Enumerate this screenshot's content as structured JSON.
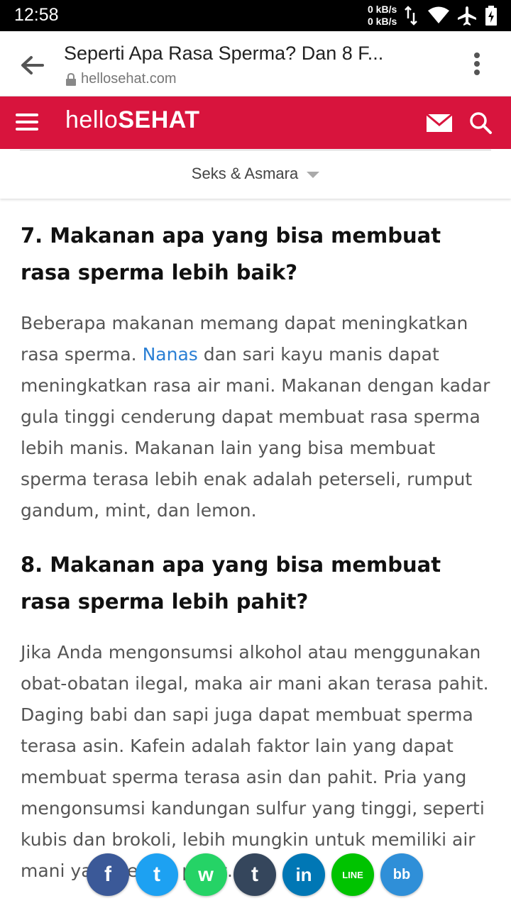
{
  "status": {
    "time": "12:58",
    "net_up": "0 kB/s",
    "net_down": "0 kB/s"
  },
  "browser": {
    "title": "Seperti Apa Rasa Sperma? Dan 8 F...",
    "domain": "hellosehat.com"
  },
  "header": {
    "logo_left": "hello",
    "logo_right": "SEHAT",
    "brand_color": "#d8143d"
  },
  "subnav": {
    "category": "Seks & Asmara"
  },
  "article": {
    "h7": "7. Makanan apa yang bisa membuat rasa sperma lebih baik?",
    "p7_before": "Beberapa makanan memang dapat meningkatkan rasa sperma. ",
    "p7_link": "Nanas",
    "p7_after": " dan sari kayu manis dapat meningkatkan rasa air mani. Makanan dengan kadar gula tinggi cenderung dapat membuat rasa sperma lebih manis. Makanan lain yang bisa membuat sperma terasa lebih enak adalah peterseli, rumput gandum, mint, dan lemon.",
    "h8": "8. Makanan apa yang bisa membuat rasa sperma lebih pahit?",
    "p8": "Jika Anda mengonsumsi alkohol atau menggunakan obat-obatan ilegal, maka air mani akan terasa pahit. Daging babi dan sapi juga dapat membuat sperma terasa asin. Kafein adalah faktor lain yang dapat membuat sperma terasa asin dan pahit. Pria yang mengonsumsi kandungan sulfur yang tinggi, seperti kubis dan brokoli, lebih mungkin untuk memiliki air mani yang terasa pahit."
  },
  "share": [
    {
      "name": "facebook",
      "glyph": "f",
      "color": "#3b5998"
    },
    {
      "name": "twitter",
      "glyph": "t",
      "color": "#1da1f2"
    },
    {
      "name": "whatsapp",
      "glyph": "w",
      "color": "#25d366"
    },
    {
      "name": "tumblr",
      "glyph": "t",
      "color": "#35465c"
    },
    {
      "name": "linkedin",
      "glyph": "in",
      "color": "#0077b5"
    },
    {
      "name": "line",
      "glyph": "LINE",
      "color": "#00c300"
    },
    {
      "name": "bbm",
      "glyph": "bb",
      "color": "#2f8fd8"
    }
  ]
}
